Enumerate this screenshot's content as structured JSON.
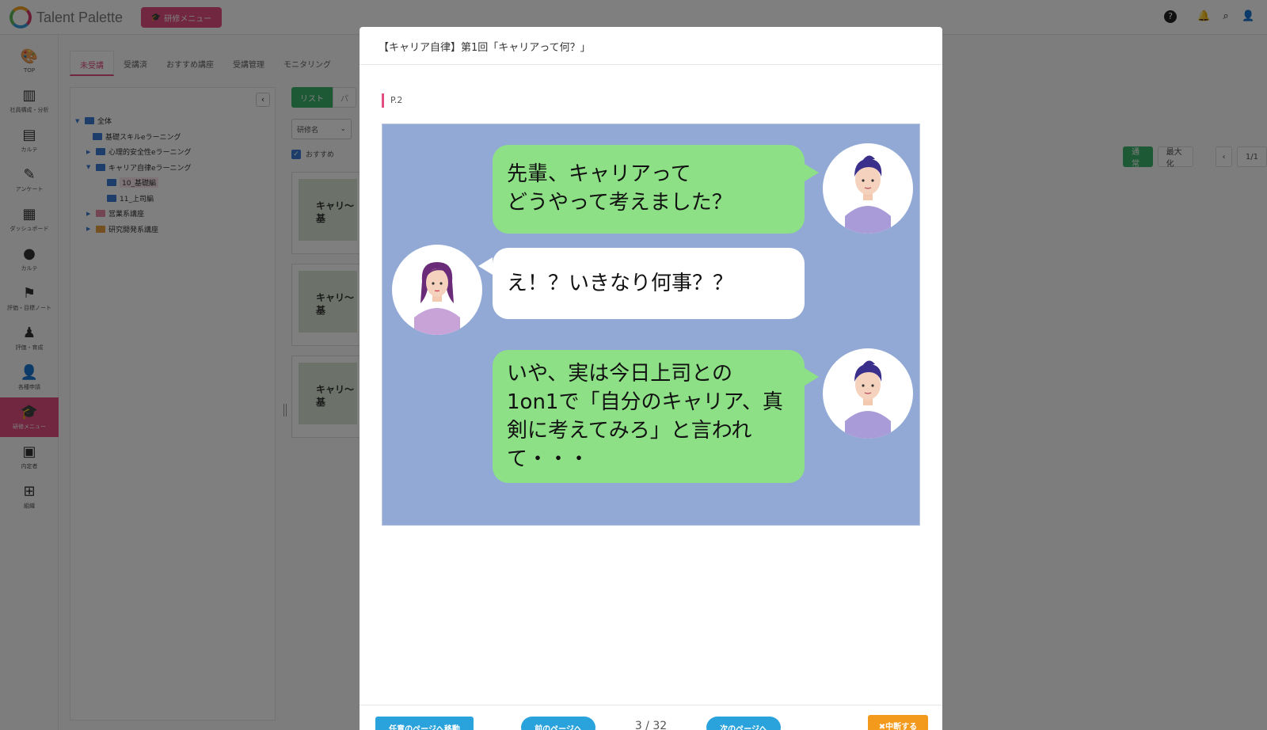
{
  "app": {
    "name": "Talent Palette",
    "menu_button": "研修メニュー"
  },
  "sidebar": {
    "items": [
      {
        "label": "TOP",
        "icon": "palette-icon"
      },
      {
        "label": "社員構成・分析",
        "icon": "chart-icon"
      },
      {
        "label": "カルテ",
        "icon": "card-icon"
      },
      {
        "label": "アンケート",
        "icon": "edit-icon"
      },
      {
        "label": "ダッシュボード",
        "icon": "dashboard-icon"
      },
      {
        "label": "カルテ",
        "icon": "brain-icon"
      },
      {
        "label": "評価・目標ノート",
        "icon": "flag-icon"
      },
      {
        "label": "評価・育成",
        "icon": "org-icon"
      },
      {
        "label": "各種申請",
        "icon": "person-edit-icon"
      },
      {
        "label": "研修メニュー",
        "icon": "graduation-icon",
        "active": true
      },
      {
        "label": "内定者",
        "icon": "id-card-icon"
      },
      {
        "label": "組織",
        "icon": "org-chart-icon"
      }
    ]
  },
  "tabs": [
    {
      "label": "未受講",
      "active": true
    },
    {
      "label": "受講済"
    },
    {
      "label": "おすすめ講座"
    },
    {
      "label": "受講管理"
    },
    {
      "label": "モニタリング"
    }
  ],
  "tree": {
    "nodes": [
      {
        "label": "全体",
        "level": 0,
        "color": "blue",
        "expanded": true
      },
      {
        "label": "基礎スキルeラーニング",
        "level": 1,
        "color": "blue"
      },
      {
        "label": "心理的安全性eラーニング",
        "level": 1,
        "color": "blue",
        "collapsed": true
      },
      {
        "label": "キャリア自律eラーニング",
        "level": 1,
        "color": "blue",
        "expanded": true
      },
      {
        "label": "10_基礎編",
        "level": 2,
        "color": "blue",
        "selected": true
      },
      {
        "label": "11_上司編",
        "level": 2,
        "color": "blue"
      },
      {
        "label": "営業系講座",
        "level": 1,
        "color": "pink",
        "collapsed": true
      },
      {
        "label": "研究開発系講座",
        "level": 1,
        "color": "orange",
        "collapsed": true
      }
    ]
  },
  "list": {
    "view_list": "リスト",
    "view_panel": "パ",
    "sort_label": "研修名",
    "recommend_filter": "おすすめ",
    "cards": [
      {
        "title": "キャリ〜基"
      },
      {
        "title": "キャリ〜基"
      },
      {
        "title": "キャリ〜基"
      }
    ]
  },
  "right_controls": {
    "normal": "通常",
    "maximize": "最大化",
    "page": "1/1"
  },
  "modal": {
    "title": "【キャリア自律】第1回「キャリアって何？」",
    "page_label": "P.2",
    "slide": {
      "background": "#91a9d4",
      "bubbles": [
        {
          "speaker": "male",
          "side": "right",
          "color": "#8de085",
          "lines": [
            "先輩、キャリアって",
            "どうやって考えました？"
          ]
        },
        {
          "speaker": "female",
          "side": "left",
          "color": "#ffffff",
          "lines": [
            "え！？いきなり何事？？"
          ]
        },
        {
          "speaker": "male",
          "side": "right",
          "color": "#8de085",
          "lines": [
            "いや、実は今日上司との",
            "1on1で「自分のキャリア、真",
            "剣に考えてみろ」と言われ",
            "て・・・"
          ]
        }
      ]
    },
    "footer": {
      "jump_button": "任意のページへ移動",
      "prev_button": "前のページへ",
      "page_indicator": "3 / 32",
      "next_button": "次のページへ",
      "stop_button": "✖中断する"
    }
  },
  "colors": {
    "accent_pink": "#e04f7f",
    "green": "#3bb26b",
    "blue_button": "#2aa3dc",
    "orange_button": "#f39a1c"
  }
}
